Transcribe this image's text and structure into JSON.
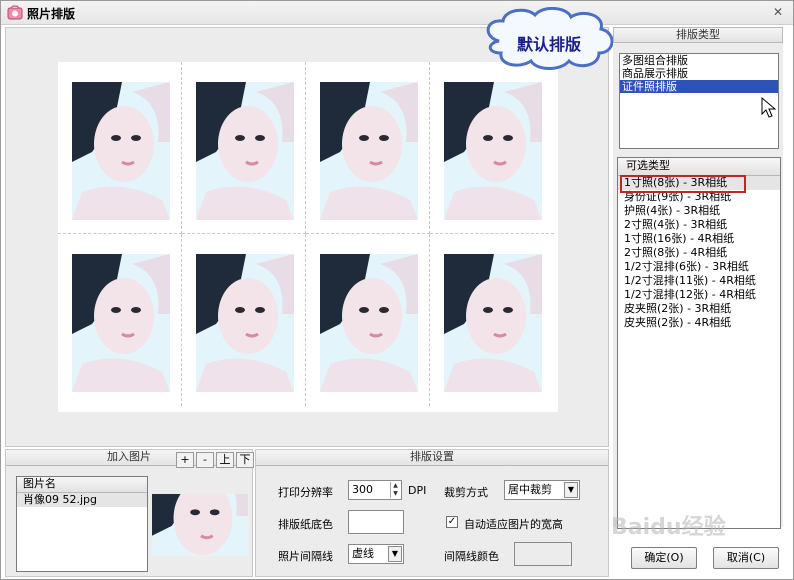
{
  "window": {
    "title": "照片排版",
    "close_glyph": "✕"
  },
  "callout": {
    "text": "默认排版"
  },
  "layout_type": {
    "header": "排版类型",
    "items": [
      "多图组合排版",
      "商品展示排版",
      "证件照排版"
    ],
    "selected_index": 2
  },
  "options": {
    "header": "可选类型",
    "items": [
      "1寸照(8张) - 3R相纸",
      "身份证(9张) - 3R相纸",
      "护照(4张) - 3R相纸",
      "2寸照(4张) - 3R相纸",
      "1寸照(16张) - 4R相纸",
      "2寸照(8张) - 4R相纸",
      "1/2寸混排(6张) - 3R相纸",
      "1/2寸混排(11张) - 4R相纸",
      "1/2寸混排(12张) - 4R相纸",
      "皮夹照(2张) - 3R相纸",
      "皮夹照(2张) - 4R相纸"
    ],
    "highlighted_index": 0
  },
  "add_images": {
    "header": "加入图片",
    "buttons": [
      "+",
      "-",
      "上",
      "下"
    ],
    "column": "图片名",
    "files": [
      "肖像09 52.jpg"
    ]
  },
  "settings": {
    "header": "排版设置",
    "dpi_label": "打印分辨率",
    "dpi_value": "300",
    "dpi_unit": "DPI",
    "crop_label": "裁剪方式",
    "crop_value": "居中裁剪",
    "bg_label": "排版纸底色",
    "auto_fit_label": "自动适应图片的宽高",
    "auto_fit_checked": true,
    "gap_line_label": "照片间隔线",
    "gap_line_value": "虚线",
    "gap_color_label": "间隔线颜色"
  },
  "buttons": {
    "ok": "确定(O)",
    "cancel": "取消(C)"
  },
  "watermark": "Baidu经验",
  "colors": {
    "selection": "#2d53b8",
    "highlight_box": "#c02626",
    "callout_text": "#1a1f8a"
  }
}
